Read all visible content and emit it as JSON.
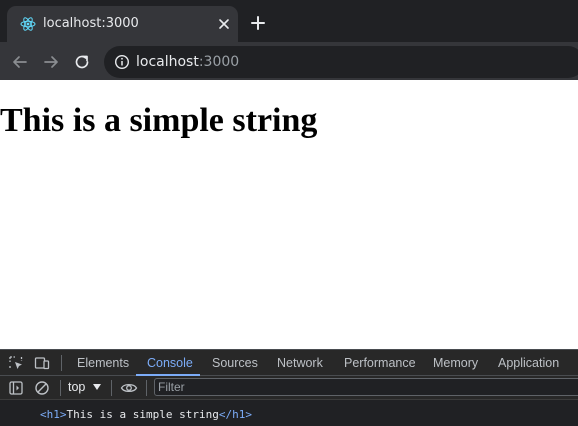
{
  "browser": {
    "tab": {
      "title": "localhost:3000",
      "favicon": "react-logo-icon"
    },
    "address_bar": {
      "host": "localhost",
      "port": ":3000"
    }
  },
  "page": {
    "heading": "This is a simple string"
  },
  "devtools": {
    "tabs": [
      "Elements",
      "Console",
      "Sources",
      "Network",
      "Performance",
      "Memory",
      "Application"
    ],
    "active_tab": "Console",
    "console_toolbar": {
      "context": "top",
      "filter_placeholder": "Filter"
    },
    "console_output": {
      "open_tag": "<h1>",
      "text": "This is a simple string",
      "close_tag": "</h1>"
    }
  },
  "colors": {
    "tabstrip_bg": "#202124",
    "toolbar_bg": "#35363a",
    "devtools_accent": "#7cacf8",
    "react_blue": "#61dafb"
  }
}
